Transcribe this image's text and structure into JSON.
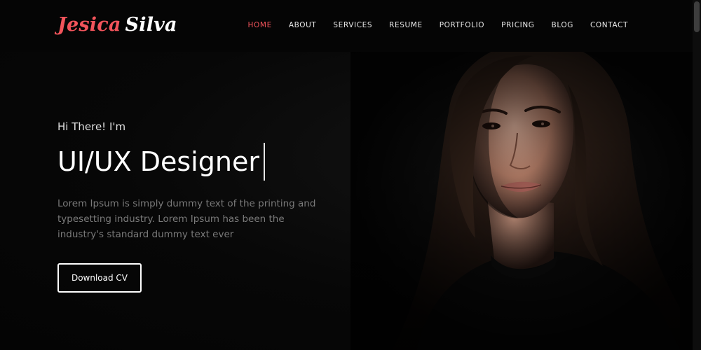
{
  "logo": {
    "first_name": "Jesica",
    "last_name": "Silva"
  },
  "nav": {
    "items": [
      {
        "label": "HOME",
        "active": true
      },
      {
        "label": "ABOUT",
        "active": false
      },
      {
        "label": "SERVICES",
        "active": false
      },
      {
        "label": "RESUME",
        "active": false
      },
      {
        "label": "PORTFOLIO",
        "active": false
      },
      {
        "label": "PRICING",
        "active": false
      },
      {
        "label": "BLOG",
        "active": false
      },
      {
        "label": "CONTACT",
        "active": false
      }
    ]
  },
  "hero": {
    "greeting": "Hi There! I'm",
    "role": "UI/UX Designer",
    "description": "Lorem Ipsum is simply dummy text of the printing and typesetting industry. Lorem Ipsum has been the industry's standard dummy text ever",
    "button_label": "Download CV"
  },
  "colors": {
    "accent": "#f2545b",
    "background": "#060606",
    "text": "#ffffff",
    "muted_text": "#7a7a7a"
  }
}
